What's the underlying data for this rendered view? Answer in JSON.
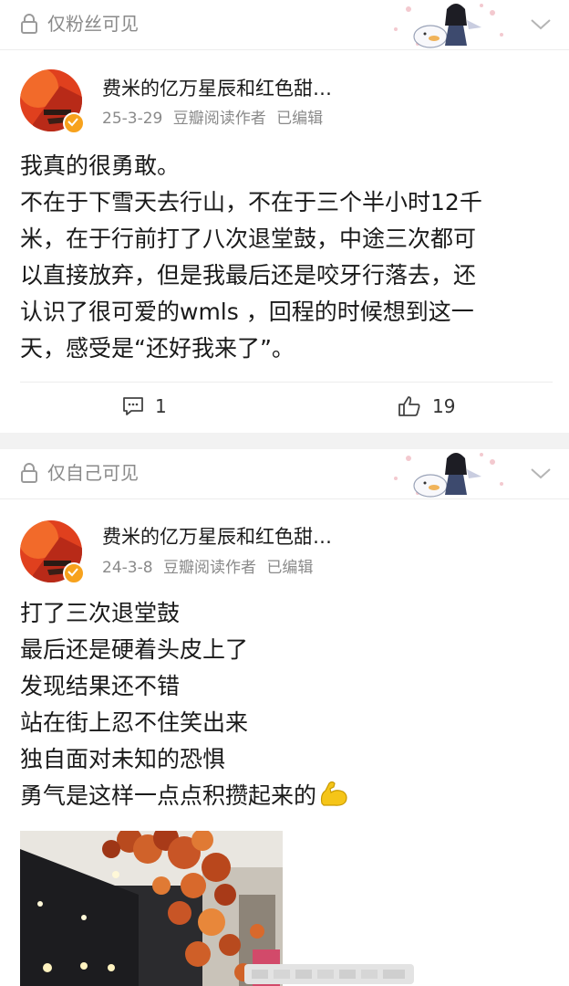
{
  "posts": [
    {
      "visibility": "仅粉丝可见",
      "author": "费米的亿万星辰和红色甜…",
      "date": "25-3-29",
      "source": "豆瓣阅读作者",
      "edited": "已编辑",
      "lines": [
        "我真的很勇敢。",
        "不在于下雪天去行山，不在于三个半小时12千",
        "米，在于行前打了八次退堂鼓，中途三次都可",
        "以直接放弃，但是我最后还是咬牙行落去，还",
        "认识了很可爱的wmls ，回程的时候想到这一",
        "天，感受是“还好我来了”。"
      ],
      "comments": "1",
      "likes": "19"
    },
    {
      "visibility": "仅自己可见",
      "author": "费米的亿万星辰和红色甜…",
      "date": "24-3-8",
      "source": "豆瓣阅读作者",
      "edited": "已编辑",
      "lines": [
        "打了三次退堂鼓",
        "最后还是硬着头皮上了",
        "发现结果还不错",
        "站在街上忍不住笑出来",
        "独自面对未知的恐惧",
        "勇气是这样一点点积攒起来的"
      ],
      "emoji": "flexed-biceps"
    }
  ],
  "colors": {
    "accent_badge": "#f7a21d",
    "muted_text": "#8a8a8a",
    "page_bg": "#f2f2f2"
  }
}
